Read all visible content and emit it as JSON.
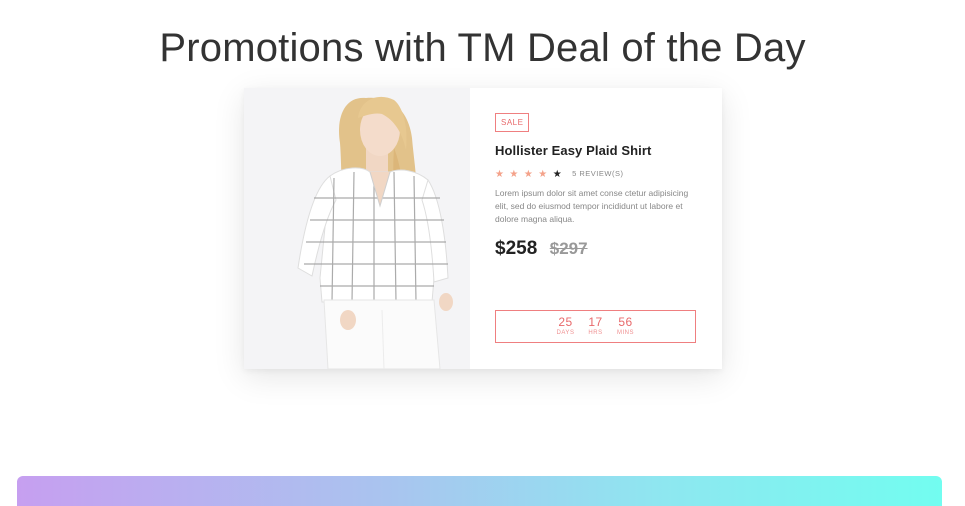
{
  "page": {
    "heading": "Promotions with TM Deal of the Day"
  },
  "product": {
    "badge": "SALE",
    "title": "Hollister Easy Plaid Shirt",
    "rating": 4,
    "rating_max": 5,
    "reviews_label": "5 REVIEW(S)",
    "description": "Lorem ipsum dolor sit amet conse ctetur adipisicing elit, sed do eiusmod tempor incididunt ut labore et dolore magna aliqua.",
    "price_current": "$258",
    "price_old": "$297",
    "image_icon": "model-photo"
  },
  "countdown": {
    "days_value": "25",
    "days_label": "DAYS",
    "hours_value": "17",
    "hours_label": "HRS",
    "minutes_value": "56",
    "minutes_label": "MINS"
  },
  "colors": {
    "accent": "#e8696b",
    "star": "#f4a28a",
    "gradient_start": "#c69ff0",
    "gradient_end": "#72fdf0"
  }
}
